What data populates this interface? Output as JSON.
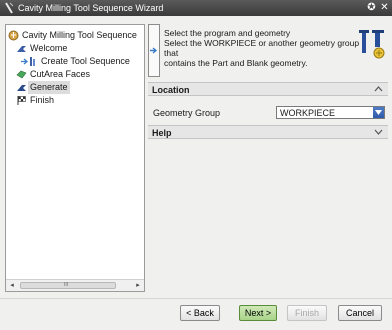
{
  "window": {
    "title": "Cavity Milling Tool Sequence Wizard",
    "help_glyph": "✪",
    "close_glyph": "✕"
  },
  "tree": {
    "items": [
      {
        "label": "Cavity Milling Tool Sequence",
        "icon": "cavity-milling-icon"
      },
      {
        "label": "Welcome",
        "icon": "welcome-icon"
      },
      {
        "label": "Create Tool Sequence",
        "icon": "tool-sequence-icon"
      },
      {
        "label": "CutArea Faces",
        "icon": "faces-icon"
      },
      {
        "label": "Generate",
        "icon": "generate-icon"
      },
      {
        "label": "Finish",
        "icon": "finish-flag-icon"
      }
    ],
    "scroll_grip": "III"
  },
  "instruction": {
    "lines": [
      "Select the program and geometry",
      "Select the WORKPIECE or another geometry group that",
      "contains the Part and Blank geometry."
    ]
  },
  "location": {
    "header": "Location",
    "geometry_group_label": "Geometry Group",
    "geometry_group_value": "WORKPIECE"
  },
  "help": {
    "header": "Help"
  },
  "buttons": {
    "back": "< Back",
    "next": "Next >",
    "finish": "Finish",
    "cancel": "Cancel"
  },
  "colors": {
    "titlebar": "#3a3a3a",
    "next_button": "#a9d489",
    "dropdown": "#2f5aa8"
  }
}
